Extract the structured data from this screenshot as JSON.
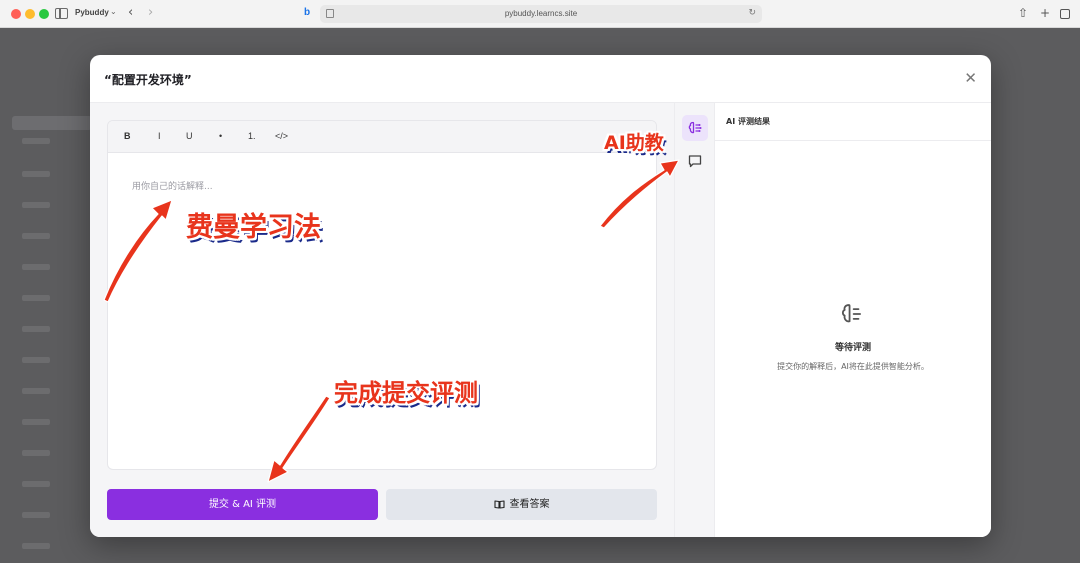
{
  "browser": {
    "tab_name": "Pybuddy",
    "url": "pybuddy.learncs.site"
  },
  "modal": {
    "title": "“配置开发环境”",
    "close_label": "✕"
  },
  "editor": {
    "toolbar": {
      "bold": "B",
      "italic": "I",
      "underline": "U",
      "bullet": "•",
      "ordered": "1.",
      "code": "</>"
    },
    "placeholder": "用你自己的话解释..."
  },
  "actions": {
    "submit_label": "提交 & AI 评测",
    "answer_label": "查看答案"
  },
  "right_panel": {
    "header": "AI 评测结果",
    "waiting_title": "等待评测",
    "waiting_desc": "提交你的解释后，AI将在此提供智能分析。"
  },
  "annotations": {
    "ai_assistant": "AI助教",
    "feynman": "费曼学习法",
    "submit": "完成提交评测"
  },
  "colors": {
    "accent": "#8a2fe0",
    "annotation": "#e8341c"
  },
  "icons": [
    "brain-icon",
    "chat-icon",
    "book-icon",
    "close-icon"
  ]
}
